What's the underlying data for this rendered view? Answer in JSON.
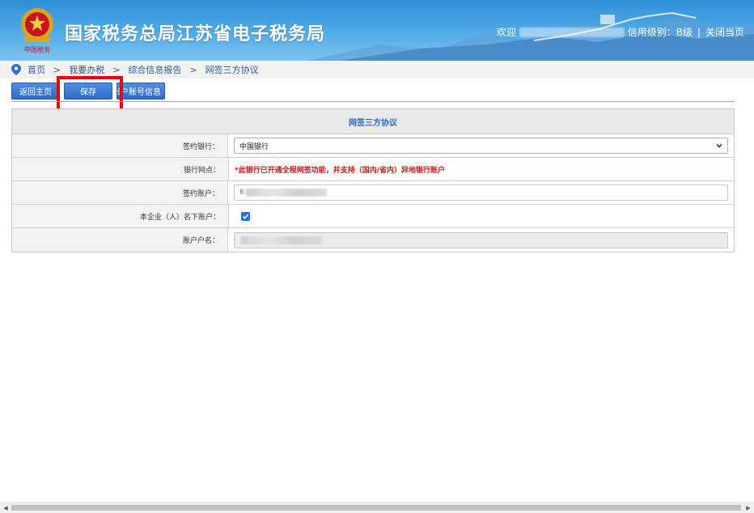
{
  "header": {
    "site_title": "国家税务总局江苏省电子税务局",
    "welcome": "欢迎",
    "credit_level": "信用级别：B级",
    "separator": "|",
    "close_page": "关闭当页"
  },
  "breadcrumb": {
    "items": [
      "首页",
      "我要办税",
      "综合信息报告",
      "网签三方协议"
    ],
    "arrow": ">"
  },
  "toolbar": {
    "back_label": "返回主页",
    "save_label": "保存",
    "account_label": "账户账号信息"
  },
  "form": {
    "title": "网签三方协议",
    "rows": {
      "bank_label": "签约银行：",
      "bank_value": "中国银行",
      "branch_label": "银行网点：",
      "branch_notice": "*此银行已开通全程网签功能，并支持（国内/省内）异地银行账户",
      "account_label": "签约账户：",
      "account_prefix": "6",
      "own_account_label": "本企业（人）名下账户：",
      "own_account_checked": true,
      "holder_label": "账户户名："
    }
  },
  "colors": {
    "header_blue": "#2f8fd6",
    "button_blue": "#2d6cc9",
    "highlight_red": "#e8000b",
    "notice_red": "#d2151b",
    "title_blue": "#2f6bc2"
  },
  "icons": {
    "location": "location-pin-icon",
    "dropdown": "chevron-down-icon",
    "check": "check-icon"
  }
}
